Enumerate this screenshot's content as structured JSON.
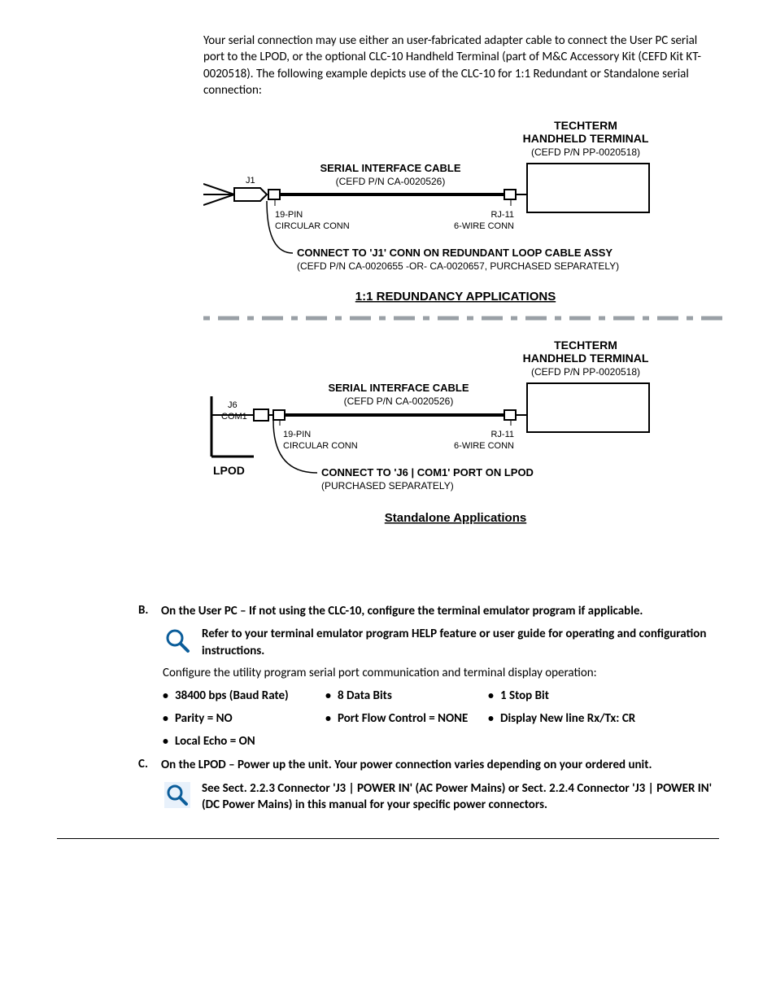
{
  "intro": "Your serial connection may use either an user-fabricated adapter cable to connect the User PC serial port to the LPOD, or the optional CLC-10 Handheld Terminal (part of M&C Accessory Kit (CEFD Kit KT-0020518). The following example depicts use of the CLC-10 for 1:1 Redundant or Standalone serial connection:",
  "diagram": {
    "techterm_title": "TECHTERM",
    "techterm_sub": "HANDHELD TERMINAL",
    "techterm_pn": "(CEFD P/N PP-0020518)",
    "serial_cable_title": "SERIAL INTERFACE CABLE",
    "serial_cable_pn": "(CEFD P/N CA-0020526)",
    "j1": "J1",
    "conn19": "19-PIN",
    "conn19b": "CIRCULAR CONN",
    "rj11": "RJ-11",
    "rj11b": "6-WIRE CONN",
    "connect_j1": "CONNECT TO 'J1' CONN ON REDUNDANT LOOP CABLE ASSY",
    "connect_j1_sub": "(CEFD P/N CA-0020655 -OR- CA-0020657, PURCHASED SEPARATELY)",
    "heading_redundancy": "1:1 REDUNDANCY APPLICATIONS",
    "j6": "J6",
    "com1": "COM1",
    "lpod": "LPOD",
    "connect_j6": "CONNECT TO 'J6 | COM1' PORT ON LPOD",
    "connect_j6_sub": "(PURCHASED SEPARATELY)",
    "heading_standalone": "Standalone Applications"
  },
  "items": {
    "B": {
      "marker": "B.",
      "lead_bold": "On the User PC – If not using the CLC-10, configure the terminal emulator program if applicable.",
      "callout": "Refer to your terminal emulator program HELP feature or user guide for operating and configuration instructions.",
      "config_line": "Configure the utility program serial port communication and terminal display operation:",
      "bullets": {
        "r1c1": "38400 bps (Baud Rate)",
        "r1c2": "8 Data Bits",
        "r1c3": "1 Stop Bit",
        "r2c1": "Parity = NO",
        "r2c2": "Port Flow Control = NONE",
        "r2c3": "Display New line Rx/Tx: CR",
        "r3c1": "Local Echo = ON"
      }
    },
    "C": {
      "marker": "C.",
      "lead_bold": "On the LPOD – Power up the unit. Your power connection varies depending on your ordered unit.",
      "callout": "See Sect. 2.2.3 Connector 'J3 | POWER IN' (AC Power Mains) or Sect. 2.2.4 Connector 'J3 | POWER IN' (DC Power Mains) in this manual for your specific power connectors."
    }
  }
}
